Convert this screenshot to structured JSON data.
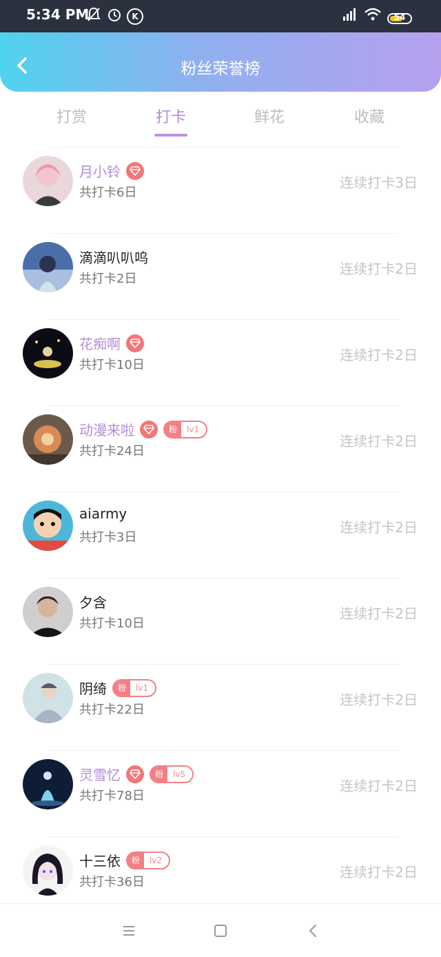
{
  "status_bar": {
    "time": "5:34 PM",
    "battery_level": "54",
    "icons": [
      "mute-bell-icon",
      "alarm-icon",
      "k-icon",
      "hd-signal-icon",
      "wifi-icon",
      "battery-icon"
    ]
  },
  "header": {
    "title": "粉丝荣誉榜",
    "back_icon": "chevron-left-icon",
    "gradient": [
      "#4fd3ee",
      "#b6a0ee"
    ]
  },
  "tabs": [
    {
      "label": "打赏",
      "active": false
    },
    {
      "label": "打卡",
      "active": true
    },
    {
      "label": "鲜花",
      "active": false
    },
    {
      "label": "收藏",
      "active": false
    }
  ],
  "accent_color": "#b58ad8",
  "badge_color": "#f3767a",
  "fans": [
    {
      "name": "月小铃",
      "vip": true,
      "diamond": true,
      "fan_badge": null,
      "total": "共打卡6日",
      "streak": "连续打卡3日"
    },
    {
      "name": "滴滴叭叭呜",
      "vip": false,
      "diamond": false,
      "fan_badge": null,
      "total": "共打卡2日",
      "streak": "连续打卡2日"
    },
    {
      "name": "花痴啊",
      "vip": true,
      "diamond": true,
      "fan_badge": null,
      "total": "共打卡10日",
      "streak": "连续打卡2日"
    },
    {
      "name": "动漫来啦",
      "vip": true,
      "diamond": true,
      "fan_badge": {
        "label": "粉",
        "level": "lv1"
      },
      "total": "共打卡24日",
      "streak": "连续打卡2日"
    },
    {
      "name": "aiarmy",
      "vip": false,
      "diamond": false,
      "fan_badge": null,
      "total": "共打卡3日",
      "streak": "连续打卡2日"
    },
    {
      "name": "夕含",
      "vip": false,
      "diamond": false,
      "fan_badge": null,
      "total": "共打卡10日",
      "streak": "连续打卡2日"
    },
    {
      "name": "阴绮",
      "vip": false,
      "diamond": false,
      "fan_badge": {
        "label": "粉",
        "level": "lv1"
      },
      "total": "共打卡22日",
      "streak": "连续打卡2日"
    },
    {
      "name": "灵雪忆",
      "vip": true,
      "diamond": true,
      "fan_badge": {
        "label": "粉",
        "level": "lv5"
      },
      "total": "共打卡78日",
      "streak": "连续打卡2日"
    },
    {
      "name": "十三依",
      "vip": false,
      "diamond": false,
      "fan_badge": {
        "label": "粉",
        "level": "lv2"
      },
      "total": "共打卡36日",
      "streak": "连续打卡2日"
    }
  ],
  "nav_bar": {
    "icons": [
      "menu-icon",
      "home-square-icon",
      "back-triangle-icon"
    ]
  }
}
